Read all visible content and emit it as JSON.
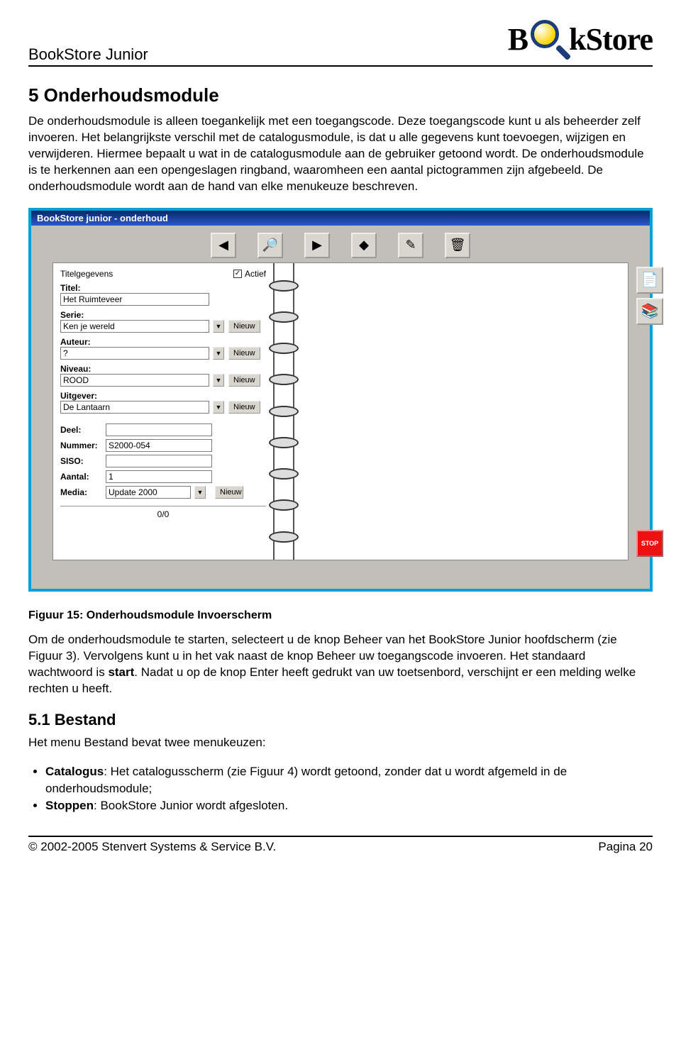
{
  "header": {
    "doc_title": "BookStore Junior",
    "logo_left": "B",
    "logo_right": "kStore"
  },
  "section5": {
    "heading": "5  Onderhoudsmodule",
    "intro": "De onderhoudsmodule is alleen toegankelijk met een toegangscode. Deze toegangscode kunt u als beheerder zelf invoeren. Het belangrijkste verschil met de catalogusmodule, is dat u alle gegevens kunt toevoegen, wijzigen en verwijderen. Hiermee bepaalt u wat in de catalogusmodule aan de gebruiker getoond wordt. De onderhoudsmodule is te herkennen aan een opengeslagen ringband, waaromheen een aantal pictogrammen zijn afgebeeld. De onderhoudsmodule wordt aan de hand van elke menukeuze beschreven."
  },
  "app": {
    "window_title": "BookStore junior - onderhoud",
    "toolbar_icons": [
      "◀",
      "🔎",
      " ▶",
      "◆",
      "✎",
      "🗑"
    ],
    "side_icons": [
      "📄",
      "📚"
    ],
    "stop_label": "STOP",
    "actief_label": "Actief",
    "actief_checked": "✓",
    "section_label": "Titelgegevens",
    "fields": {
      "titel_label": "Titel:",
      "titel_value": "Het Ruimteveer",
      "serie_label": "Serie:",
      "serie_value": "Ken je wereld",
      "auteur_label": "Auteur:",
      "auteur_value": "?",
      "niveau_label": "Niveau:",
      "niveau_value": "ROOD",
      "uitgever_label": "Uitgever:",
      "uitgever_value": "De Lantaarn",
      "deel_label": "Deel:",
      "deel_value": "",
      "nummer_label": "Nummer:",
      "nummer_value": "S2000-054",
      "siso_label": "SISO:",
      "siso_value": "",
      "aantal_label": "Aantal:",
      "aantal_value": "1",
      "media_label": "Media:",
      "media_value": "Update 2000"
    },
    "nieuw_label": "Nieuw",
    "pager": "0/0"
  },
  "fig_caption": "Figuur 15: Onderhoudsmodule   Invoerscherm",
  "after_fig_para_parts": {
    "p1a": "Om de onderhoudsmodule te starten, selecteert u de knop  Beheer  van het BookStore Junior hoofdscherm (zie Figuur 3). Vervolgens kunt u in het vak naast de knop  Beheer  uw toegangscode invoeren. Het standaard wachtwoord is ",
    "p1_strong": "start",
    "p1b": ". Nadat u op de knop  Enter  heeft gedrukt van uw toetsenbord, verschijnt er een melding welke rechten u heeft."
  },
  "section51": {
    "heading": "5.1  Bestand",
    "intro": "Het menu Bestand bevat twee menukeuzen:",
    "bullets": [
      {
        "bold": "Catalogus",
        "rest": ": Het catalogusscherm (zie Figuur 4) wordt getoond, zonder dat u wordt afgemeld in de onderhoudsmodule;"
      },
      {
        "bold": "Stoppen",
        "rest": ": BookStore Junior wordt afgesloten."
      }
    ]
  },
  "footer": {
    "copyright": "© 2002-2005 Stenvert Systems & Service B.V.",
    "page": "Pagina 20"
  }
}
